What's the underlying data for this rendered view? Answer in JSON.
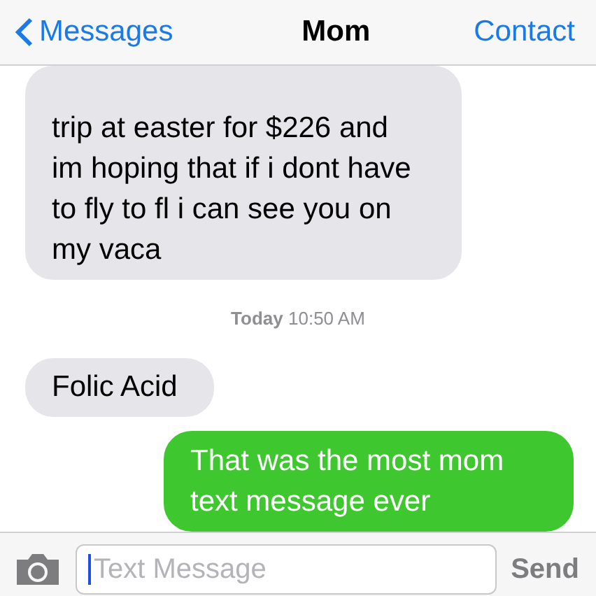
{
  "nav": {
    "back": "Messages",
    "title": "Mom",
    "action": "Contact"
  },
  "messages": [
    {
      "kind": "received",
      "text": "trip at easter for $226 and im hoping that if i dont have to fly to fl i can see you on my vaca"
    },
    {
      "kind": "timestamp",
      "day": "Today",
      "time": "10:50 AM"
    },
    {
      "kind": "received",
      "text": "Folic Acid"
    },
    {
      "kind": "sent",
      "text": "That was the most mom text message ever"
    }
  ],
  "composer": {
    "placeholder": "Text Message",
    "focused": true,
    "send": "Send"
  }
}
